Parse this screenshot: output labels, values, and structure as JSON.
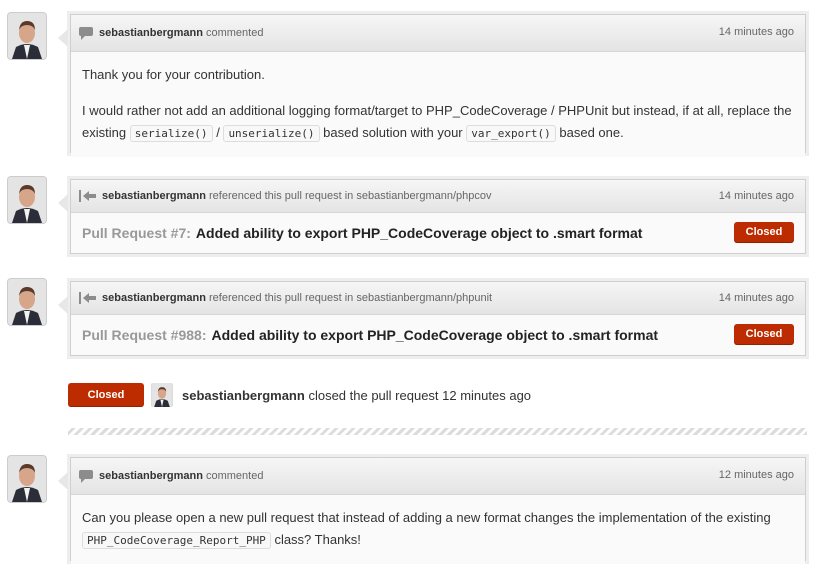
{
  "user": "sebastianbergmann",
  "items": [
    {
      "kind": "comment",
      "action": "commented",
      "time": "14 minutes ago",
      "p1": "Thank you for your contribution.",
      "p2_a": "I would rather not add an additional logging format/target to PHP_CodeCoverage / PHPUnit but instead, if at all, replace the existing",
      "code1": "serialize()",
      "sep": "/",
      "code2": "unserialize()",
      "p2_b": "based solution with your",
      "code3": "var_export()",
      "p2_c": "based one."
    },
    {
      "kind": "reference",
      "action": "referenced this pull request in sebastianbergmann/phpcov",
      "time": "14 minutes ago",
      "pr_number": "Pull Request #7:",
      "pr_title": "Added ability to export PHP_CodeCoverage object to .smart format",
      "state": "Closed"
    },
    {
      "kind": "reference",
      "action": "referenced this pull request in sebastianbergmann/phpunit",
      "time": "14 minutes ago",
      "pr_number": "Pull Request #988:",
      "pr_title": "Added ability to export PHP_CodeCoverage object to .smart format",
      "state": "Closed"
    },
    {
      "kind": "comment",
      "action": "commented",
      "time": "12 minutes ago",
      "p1_a": "Can you please open a new pull request that instead of adding a new format changes the implementation of the existing",
      "code1": "PHP_CodeCoverage_Report_PHP",
      "p1_b": "class? Thanks!"
    }
  ],
  "event": {
    "state": "Closed",
    "text": "closed the pull request 12 minutes ago"
  },
  "colors": {
    "closed": "#bd2c00",
    "border": "#cfcfcf",
    "header": "#e9e9e9"
  }
}
